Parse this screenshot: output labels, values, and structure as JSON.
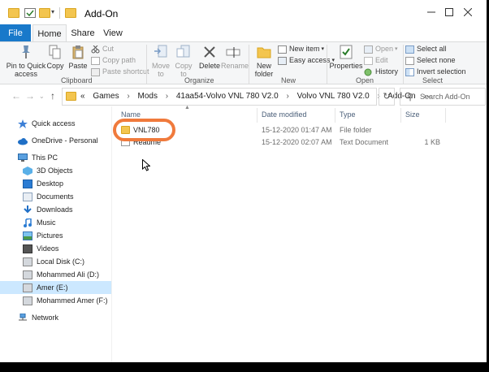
{
  "window": {
    "title": "Add-On"
  },
  "ribbon_tabs": [
    "File",
    "Home",
    "Share",
    "View"
  ],
  "clipboard_group": {
    "label": "Clipboard",
    "pin_label": "Pin to Quick access",
    "copy_label": "Copy",
    "paste_label": "Paste",
    "cut_label": "Cut",
    "copy_path_label": "Copy path",
    "paste_shortcut_label": "Paste shortcut"
  },
  "organize_group": {
    "label": "Organize",
    "move_to_label": "Move to",
    "copy_to_label": "Copy to",
    "delete_label": "Delete",
    "rename_label": "Rename"
  },
  "new_group": {
    "label": "New",
    "new_folder_label": "New folder",
    "new_item_label": "New item",
    "easy_access_label": "Easy access"
  },
  "open_group": {
    "label": "Open",
    "properties_label": "Properties",
    "open_label": "Open",
    "edit_label": "Edit",
    "history_label": "History"
  },
  "select_group": {
    "label": "Select",
    "select_all_label": "Select all",
    "select_none_label": "Select none",
    "invert_label": "Invert selection"
  },
  "address": {
    "crumbs": [
      "Games",
      "Mods",
      "41aa54-Volvo VNL 780 V2.0",
      "Volvo VNL 780 V2.0",
      "Add-On"
    ],
    "overflow": "«",
    "separator": "›"
  },
  "search": {
    "placeholder": "Search Add-On"
  },
  "sidebar": {
    "items": [
      {
        "label": "Quick access",
        "icon": "star-icon"
      },
      {
        "label": "OneDrive - Personal",
        "icon": "cloud-icon"
      },
      {
        "label": "This PC",
        "icon": "computer-icon"
      },
      {
        "label": "3D Objects",
        "icon": "cube-icon"
      },
      {
        "label": "Desktop",
        "icon": "desktop-icon"
      },
      {
        "label": "Documents",
        "icon": "document-icon"
      },
      {
        "label": "Downloads",
        "icon": "download-icon"
      },
      {
        "label": "Music",
        "icon": "music-icon"
      },
      {
        "label": "Pictures",
        "icon": "pictures-icon"
      },
      {
        "label": "Videos",
        "icon": "video-icon"
      },
      {
        "label": "Local Disk (C:)",
        "icon": "drive-icon"
      },
      {
        "label": "Mohammed Ali (D:)",
        "icon": "drive-icon"
      },
      {
        "label": "Amer (E:)",
        "icon": "drive-icon"
      },
      {
        "label": "Mohammed Amer (F:)",
        "icon": "drive-icon"
      },
      {
        "label": "Network",
        "icon": "network-icon"
      }
    ]
  },
  "columns": [
    "Name",
    "Date modified",
    "Type",
    "Size"
  ],
  "files": [
    {
      "name": "VNL780",
      "date": "15-12-2020 01:47 AM",
      "type": "File folder",
      "size": "",
      "icon": "folder-icon"
    },
    {
      "name": "Readme",
      "date": "15-12-2020 02:07 AM",
      "type": "Text Document",
      "size": "1 KB",
      "icon": "text-file-icon"
    }
  ],
  "colors": {
    "accent": "#1979ca",
    "folder": "#f3c54f",
    "highlight_ring": "#f07a3c",
    "selection": "#cce8ff"
  }
}
